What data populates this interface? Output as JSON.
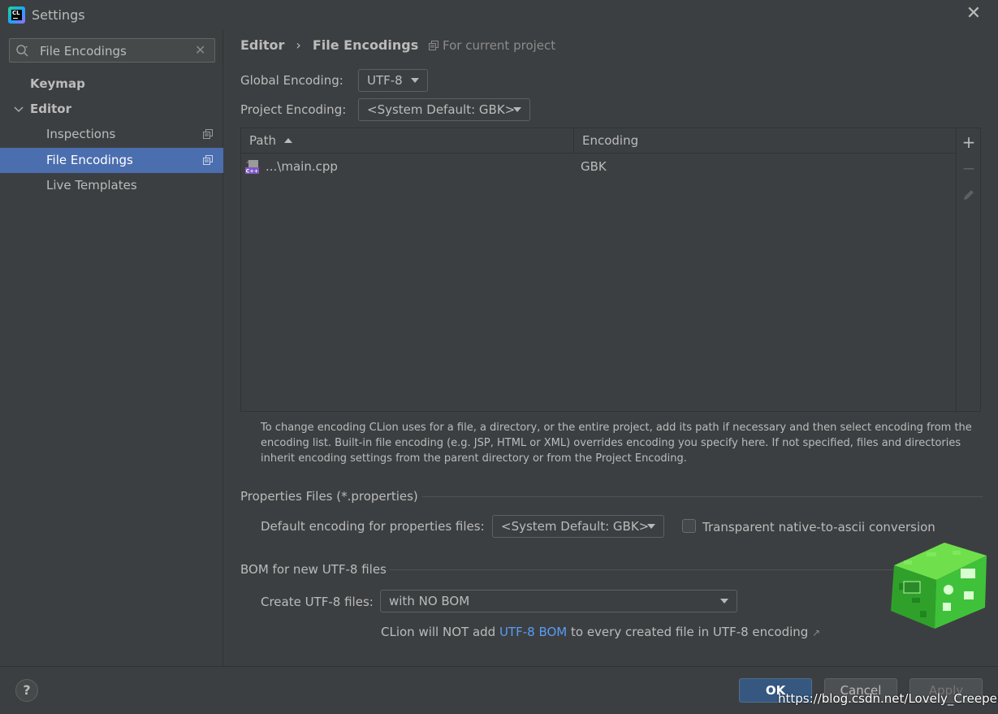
{
  "window": {
    "title": "Settings",
    "app_icon_text": "CL",
    "close_icon": "close-icon"
  },
  "sidebar": {
    "search": {
      "value": "File Encodings",
      "placeholder": ""
    },
    "items": [
      {
        "label": "Keymap",
        "bold": true
      },
      {
        "label": "Editor",
        "bold": true,
        "expanded": true
      },
      {
        "label": "Inspections"
      },
      {
        "label": "File Encodings",
        "selected": true
      },
      {
        "label": "Live Templates"
      }
    ]
  },
  "main": {
    "breadcrumb": [
      "Editor",
      "File Encodings"
    ],
    "breadcrumb_sep": "›",
    "scope_label": "For current project",
    "global_encoding": {
      "label": "Global Encoding:",
      "value": "UTF-8"
    },
    "project_encoding": {
      "label": "Project Encoding:",
      "value": "<System Default: GBK>"
    },
    "table": {
      "columns": [
        "Path",
        "Encoding"
      ],
      "rows": [
        {
          "path": "...\\main.cpp",
          "encoding": "GBK",
          "icon": "cpp-file-icon"
        }
      ],
      "tools": {
        "add": "+",
        "remove": "−"
      }
    },
    "help_text": "To change encoding CLion uses for a file, a directory, or the entire project, add its path if necessary and then select encoding from the encoding list. Built-in file encoding (e.g. JSP, HTML or XML) overrides encoding you specify here. If not specified, files and directories inherit encoding settings from the parent directory or from the Project Encoding.",
    "properties": {
      "section_title": "Properties Files (*.properties)",
      "default_label": "Default encoding for properties files:",
      "default_value": "<System Default: GBK>",
      "transparent_label": "Transparent native-to-ascii conversion",
      "transparent_checked": false
    },
    "bom": {
      "section_title": "BOM for new UTF-8 files",
      "create_label": "Create UTF-8 files:",
      "create_value": "with NO BOM",
      "note_prefix": "CLion will NOT add ",
      "note_link": "UTF-8 BOM",
      "note_suffix": " to every created file in UTF-8 encoding",
      "note_arrow": "↗"
    }
  },
  "footer": {
    "help": "?",
    "ok": "OK",
    "cancel": "Cancel",
    "apply": "Apply",
    "watermark": "https://blog.csdn.net/Lovely_Creeper"
  },
  "colors": {
    "background": "#3c3f41",
    "selection": "#4b6eaf",
    "link": "#589df6",
    "primary_button": "#365880"
  }
}
